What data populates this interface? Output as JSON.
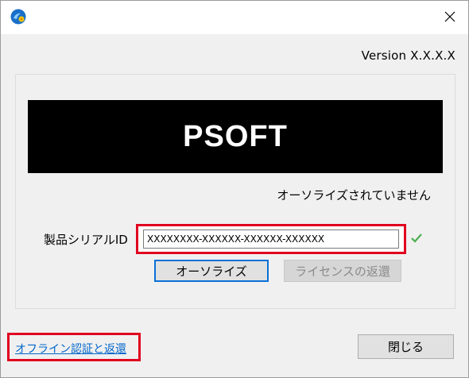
{
  "window": {
    "close_glyph": "✕",
    "app_icon": "psoft-app-icon"
  },
  "header": {
    "version": "Version X.X.X.X"
  },
  "banner": {
    "text": "PSOFT"
  },
  "status": {
    "text": "オーソライズされていません"
  },
  "serial": {
    "label": "製品シリアルID",
    "value": "XXXXXXXX-XXXXXX-XXXXXX-XXXXXX",
    "check_icon": "check-icon"
  },
  "buttons": {
    "authorize": "オーソライズ",
    "return_license": "ライセンスの返還",
    "close": "閉じる"
  },
  "links": {
    "offline": "オフライン認証と返還"
  },
  "colors": {
    "highlight": "#e0001f",
    "link": "#0066cc",
    "focus": "#0a70d8",
    "check": "#4caf50"
  }
}
